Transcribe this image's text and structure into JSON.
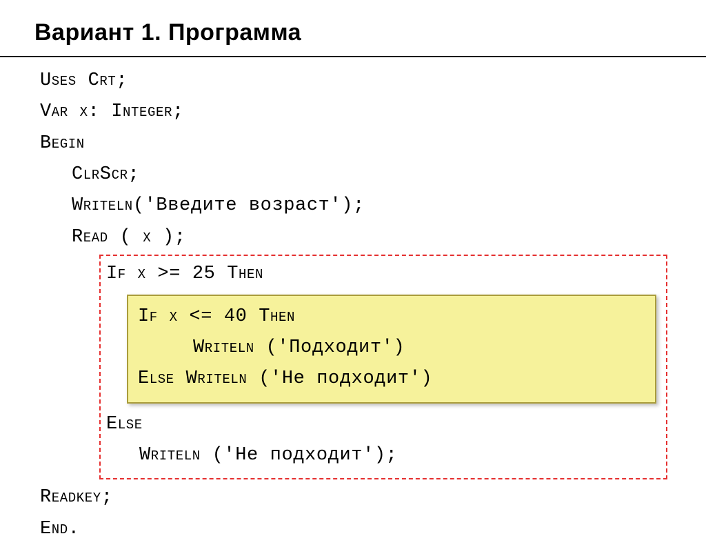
{
  "title": "Вариант 1. Программа",
  "code": {
    "l1": "Uses Crt;",
    "l2": "Var x: Integer;",
    "l3": "Begin",
    "l4": "ClrScr;",
    "l5_a": "Writeln('",
    "l5_txt": "Введите возраст",
    "l5_b": "');",
    "l6": "Read ( x );",
    "l7": "If x >= 25 Then",
    "l8": "If x <= 40 Then",
    "l9_a": "Writeln ('",
    "l9_txt": "Подходит",
    "l9_b": "')",
    "l10_a": "Else Writeln ('",
    "l10_txt": "Не подходит",
    "l10_b": "')",
    "l11": "Else",
    "l12_a": "Writeln ('",
    "l12_txt": "Не подходит",
    "l12_b": "');",
    "l13": "Readkey;",
    "l14": "End."
  }
}
